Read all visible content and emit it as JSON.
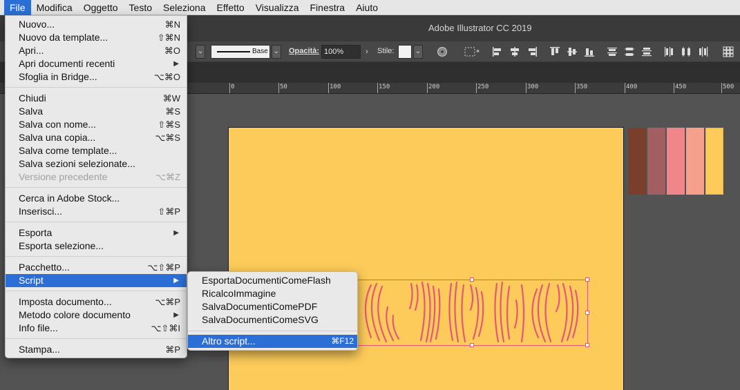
{
  "menubar": {
    "items": [
      {
        "label": "File",
        "active": true
      },
      {
        "label": "Modifica"
      },
      {
        "label": "Oggetto"
      },
      {
        "label": "Testo"
      },
      {
        "label": "Seleziona"
      },
      {
        "label": "Effetto"
      },
      {
        "label": "Visualizza"
      },
      {
        "label": "Finestra"
      },
      {
        "label": "Aiuto"
      }
    ]
  },
  "app": {
    "title": "Adobe Illustrator CC 2019"
  },
  "controlbar": {
    "stroke_profile": "Base",
    "opacity_label": "Opacità:",
    "opacity_value": "100%",
    "style_label": "Stile:"
  },
  "ruler": {
    "ticks": [
      "0",
      "50",
      "100",
      "150",
      "200",
      "250",
      "300",
      "350",
      "400",
      "450",
      "500"
    ]
  },
  "colors": {
    "artboard": "#fccb59",
    "swatches": [
      "#7a3f2a",
      "#a35e62",
      "#f0868a",
      "#f4a08c",
      "#fccb59"
    ],
    "selection": "#e8557b",
    "menu_highlight": "#2b6fd6"
  },
  "file_menu": {
    "items": [
      {
        "label": "Nuovo...",
        "shortcut": "⌘N"
      },
      {
        "label": "Nuovo da template...",
        "shortcut": "⇧⌘N"
      },
      {
        "label": "Apri...",
        "shortcut": "⌘O"
      },
      {
        "label": "Apri documenti recenti",
        "submenu": true
      },
      {
        "label": "Sfoglia in Bridge...",
        "shortcut": "⌥⌘O"
      },
      {
        "label": "Chiudi",
        "shortcut": "⌘W"
      },
      {
        "label": "Salva",
        "shortcut": "⌘S"
      },
      {
        "label": "Salva con nome...",
        "shortcut": "⇧⌘S"
      },
      {
        "label": "Salva una copia...",
        "shortcut": "⌥⌘S"
      },
      {
        "label": "Salva come template..."
      },
      {
        "label": "Salva sezioni selezionate..."
      },
      {
        "label": "Versione precedente",
        "shortcut": "⌥⌘Z",
        "disabled": true
      },
      {
        "label": "Cerca in Adobe Stock..."
      },
      {
        "label": "Inserisci...",
        "shortcut": "⇧⌘P"
      },
      {
        "label": "Esporta",
        "submenu": true
      },
      {
        "label": "Esporta selezione..."
      },
      {
        "label": "Pacchetto...",
        "shortcut": "⌥⇧⌘P"
      },
      {
        "label": "Script",
        "submenu": true,
        "highlight": true
      },
      {
        "label": "Imposta documento...",
        "shortcut": "⌥⌘P"
      },
      {
        "label": "Metodo colore documento",
        "submenu": true
      },
      {
        "label": "Info file...",
        "shortcut": "⌥⇧⌘I"
      },
      {
        "label": "Stampa...",
        "shortcut": "⌘P"
      }
    ]
  },
  "script_submenu": {
    "items": [
      {
        "label": "EsportaDocumentiComeFlash"
      },
      {
        "label": "RicalcoImmagine"
      },
      {
        "label": "SalvaDocumentiComePDF"
      },
      {
        "label": "SalvaDocumentiComeSVG"
      },
      {
        "label": "Altro script...",
        "shortcut": "⌘F12",
        "highlight": true
      }
    ]
  }
}
